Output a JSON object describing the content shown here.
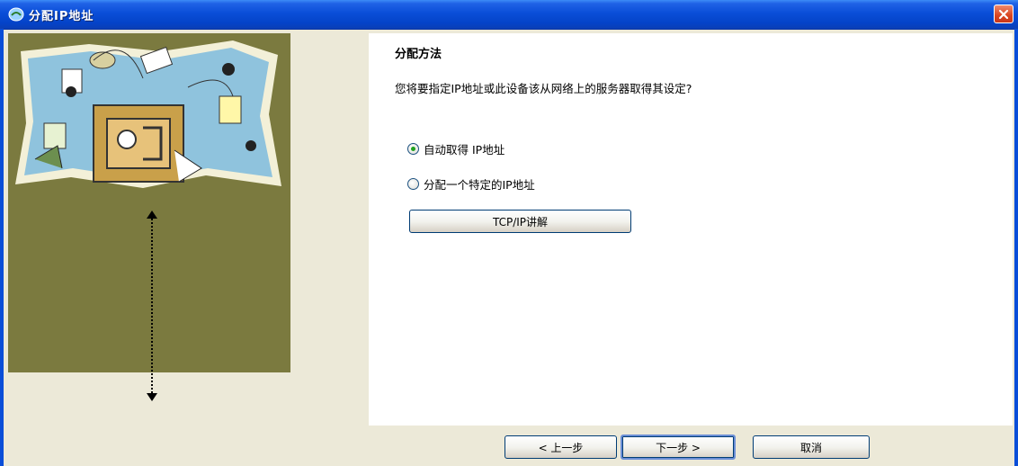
{
  "window": {
    "title": "分配IP地址",
    "colors": {
      "titlebar": "#0a4ed8",
      "panel": "#7b7a3f",
      "background": "#ece9d8"
    }
  },
  "main": {
    "heading": "分配方法",
    "question": "您将要指定IP地址或此设备该从网络上的服务器取得其设定?",
    "options": [
      {
        "label": "自动取得 IP地址",
        "selected": true
      },
      {
        "label": "分配一个特定的IP地址",
        "selected": false
      }
    ],
    "help_button": "TCP/IP讲解"
  },
  "footer": {
    "back_button": "< 上一步",
    "next_button": "下一步 >",
    "cancel_button": "取消"
  },
  "icons": [
    "app-icon",
    "close-icon",
    "illustration",
    "double-arrow-icon"
  ]
}
